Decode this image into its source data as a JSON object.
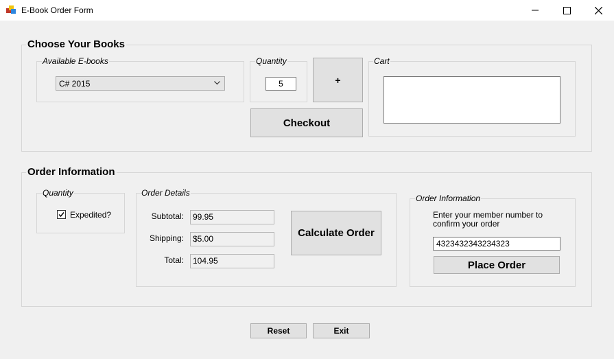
{
  "window": {
    "title": "E-Book Order Form"
  },
  "choose_books": {
    "title": "Choose Your Books",
    "available": {
      "title": "Available E-books",
      "selected": "C# 2015"
    },
    "quantity": {
      "title": "Quantity",
      "value": "5"
    },
    "add_label": "+",
    "checkout_label": "Checkout",
    "cart": {
      "title": "Cart",
      "items": []
    }
  },
  "order_info": {
    "title": "Order Information",
    "quantity_group": {
      "title": "Quantity",
      "expedited_label": "Expedited?",
      "expedited_checked": true
    },
    "details": {
      "title": "Order Details",
      "subtotal_label": "Subtotal:",
      "subtotal_value": "99.95",
      "shipping_label": "Shipping:",
      "shipping_value": "$5.00",
      "total_label": "Total:",
      "total_value": "104.95"
    },
    "calculate_label": "Calculate Order",
    "member": {
      "title": "Order Information",
      "prompt_line1": "Enter your member number to",
      "prompt_line2": "confirm your order",
      "member_number": "4323432343234323",
      "place_order_label": "Place Order"
    }
  },
  "footer": {
    "reset_label": "Reset",
    "exit_label": "Exit"
  }
}
